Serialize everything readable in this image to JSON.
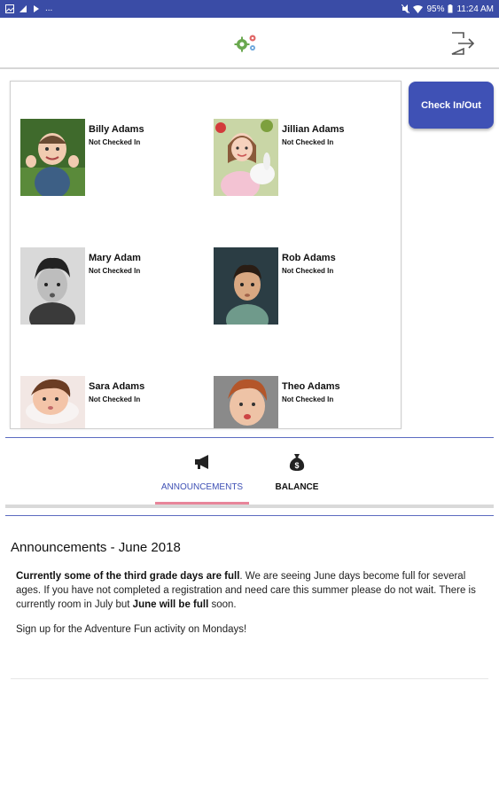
{
  "status_bar": {
    "left_icons": [
      "gallery-icon",
      "signal-icon",
      "play-icon",
      "more-notifications-icon"
    ],
    "more": "...",
    "battery": "95%",
    "time": "11:24 AM"
  },
  "header": {
    "logo_icon": "gears-logo-icon",
    "logout_icon": "logout-icon"
  },
  "children": [
    {
      "name": "Billy Adams",
      "status": "Not Checked In"
    },
    {
      "name": "Jillian Adams",
      "status": "Not Checked In"
    },
    {
      "name": "Mary Adam",
      "status": "Not Checked In"
    },
    {
      "name": "Rob Adams",
      "status": "Not Checked In"
    },
    {
      "name": "Sara Adams",
      "status": "Not Checked In"
    },
    {
      "name": "Theo Adams",
      "status": "Not Checked In"
    }
  ],
  "check_in_button": "Check In/Out",
  "tabs": [
    {
      "label": "ANNOUNCEMENTS",
      "icon": "megaphone-icon",
      "active": true
    },
    {
      "label": "BALANCE",
      "icon": "money-bag-icon",
      "active": false
    }
  ],
  "announcements": {
    "title": "Announcements - June 2018",
    "p1_bold1": "Currently some of the third grade days are full",
    "p1_text1": ". We are seeing June days become full for several ages. If you have not completed a registration and need care this summer please do not wait. There is currently room in July but ",
    "p1_bold2": "June will be full",
    "p1_text2": " soon.",
    "p2": "Sign up for the Adventure Fun activity on Mondays!"
  },
  "colors": {
    "status_bar": "#3a4ca6",
    "primary": "#3f51b5",
    "tab_indicator": "#e8859a"
  }
}
